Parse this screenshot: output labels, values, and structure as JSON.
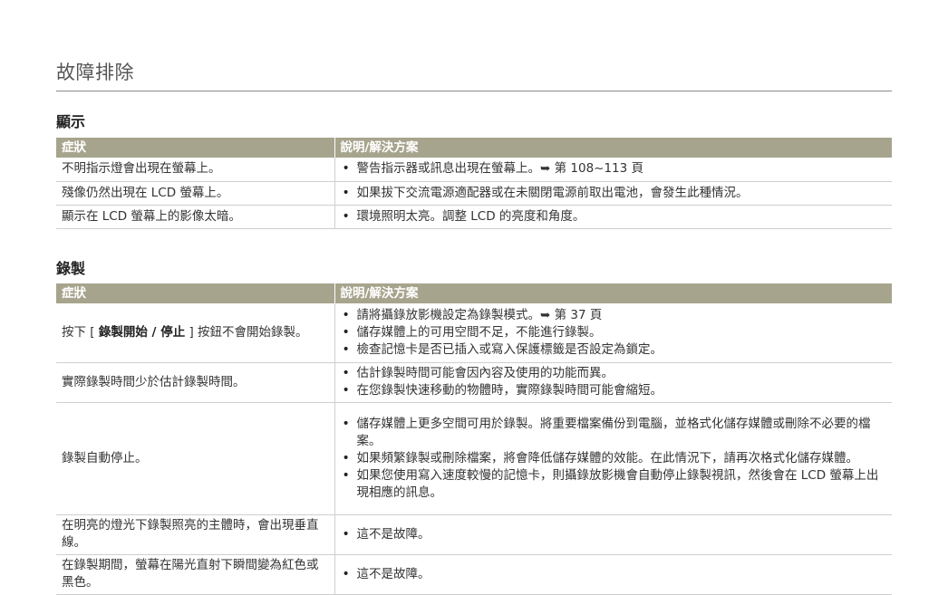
{
  "page_title": "故障排除",
  "display": {
    "heading": "顯示",
    "col_symptom": "症狀",
    "col_solution": "說明/解決方案",
    "rows": [
      {
        "symptom": "不明指示燈會出現在螢幕上。",
        "solutions": [
          "警告指示器或訊息出現在螢幕上。➥ 第 108~113 頁"
        ]
      },
      {
        "symptom": "殘像仍然出現在 LCD 螢幕上。",
        "solutions": [
          "如果拔下交流電源適配器或在未關閉電源前取出電池，會發生此種情況。"
        ]
      },
      {
        "symptom": "顯示在 LCD 螢幕上的影像太暗。",
        "solutions": [
          "環境照明太亮。調整 LCD 的亮度和角度。"
        ]
      }
    ]
  },
  "recording": {
    "heading": "錄製",
    "col_symptom": "症狀",
    "col_solution": "說明/解決方案",
    "row1": {
      "prefix": "按下 [ ",
      "bold": "錄製開始 / 停止",
      "suffix": " ] 按鈕不會開始錄製。",
      "solutions": [
        "請將攝錄放影機設定為錄製模式。➥ 第 37 頁",
        "儲存媒體上的可用空間不足，不能進行錄製。",
        "檢查記憶卡是否已插入或寫入保護標籤是否設定為鎖定。"
      ]
    },
    "row2": {
      "symptom": "實際錄製時間少於估計錄製時間。",
      "solutions": [
        "估計錄製時間可能會因內容及使用的功能而異。",
        "在您錄製快速移動的物體時，實際錄製時間可能會縮短。"
      ]
    },
    "row3": {
      "symptom": "錄製自動停止。",
      "solutions": [
        "儲存媒體上更多空間可用於錄製。將重要檔案備份到電腦，並格式化儲存媒體或刪除不必要的檔案。",
        "如果頻繁錄製或刪除檔案，將會降低儲存媒體的效能。在此情況下，請再次格式化儲存媒體。",
        "如果您使用寫入速度較慢的記憶卡，則攝錄放影機會自動停止錄製視訊，然後會在 LCD 螢幕上出現相應的訊息。"
      ]
    },
    "row4": {
      "symptom": "在明亮的燈光下錄製照亮的主體時，會出現垂直線。",
      "solutions": [
        "這不是故障。"
      ]
    },
    "row5": {
      "symptom": "在錄製期間，螢幕在陽光直射下瞬間變為紅色或黑色。",
      "solutions": [
        "這不是故障。"
      ]
    }
  }
}
